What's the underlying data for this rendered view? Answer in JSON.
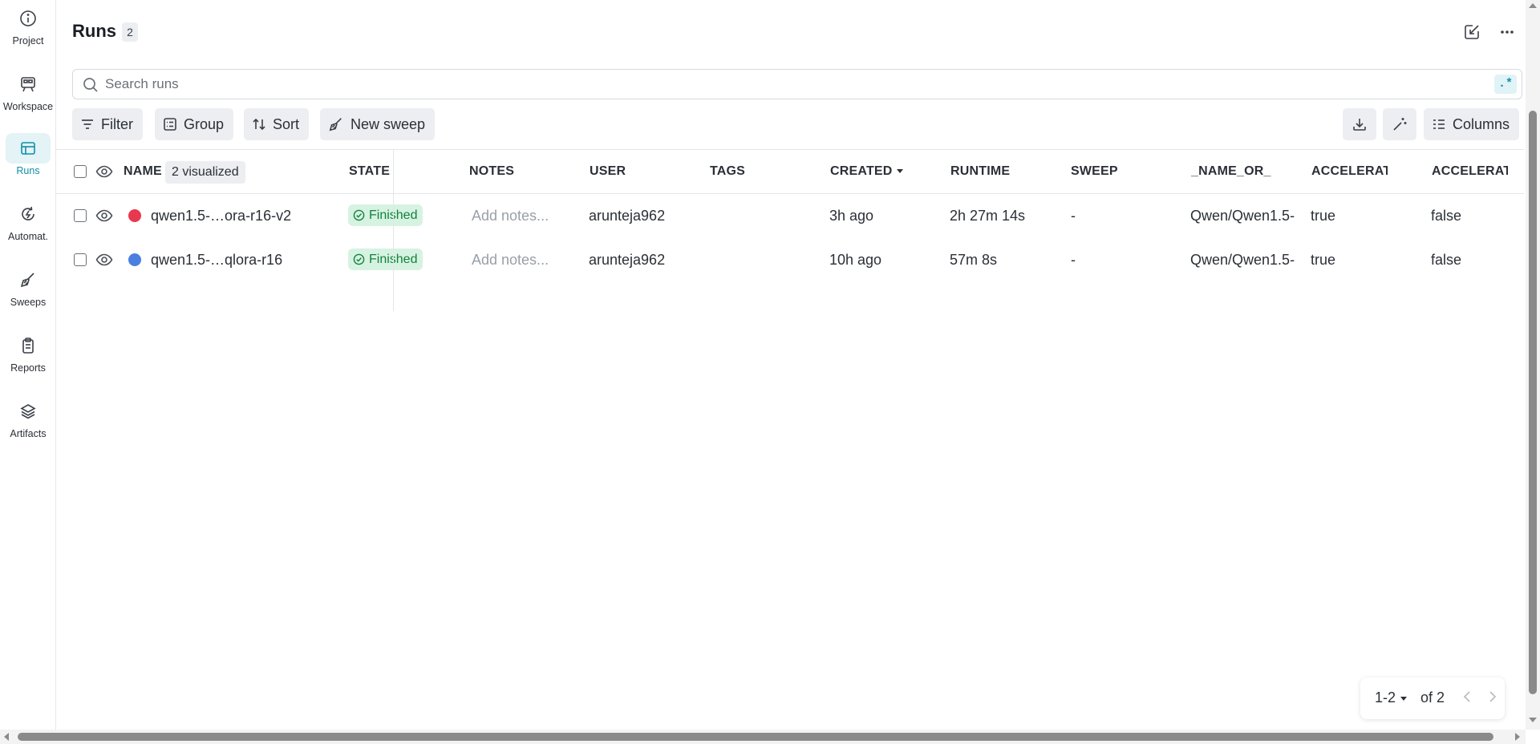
{
  "nav": {
    "items": [
      {
        "label": "Project",
        "icon": "info-icon"
      },
      {
        "label": "Workspace",
        "icon": "workspace-icon"
      },
      {
        "label": "Runs",
        "icon": "table-icon",
        "active": true
      },
      {
        "label": "Automat.",
        "icon": "automation-icon"
      },
      {
        "label": "Sweeps",
        "icon": "broom-icon"
      },
      {
        "label": "Reports",
        "icon": "clipboard-icon"
      },
      {
        "label": "Artifacts",
        "icon": "layers-icon"
      }
    ]
  },
  "header": {
    "title": "Runs",
    "count": "2"
  },
  "search": {
    "placeholder": "Search runs",
    "value": "",
    "regex_label": ".*"
  },
  "toolbar": {
    "filter_label": "Filter",
    "group_label": "Group",
    "sort_label": "Sort",
    "new_sweep_label": "New sweep",
    "columns_label": "Columns"
  },
  "table": {
    "visualized_label": "2 visualized",
    "columns": {
      "name": "NAME",
      "state": "STATE",
      "notes": "NOTES",
      "user": "USER",
      "tags": "TAGS",
      "created": "CREATED",
      "runtime": "RUNTIME",
      "sweep": "SWEEP",
      "name_or": "_NAME_OR_",
      "accel1": "ACCELERATC",
      "accel2": "ACCELERATC"
    },
    "rows": [
      {
        "name": "qwen1.5-…ora-r16-v2",
        "color": "#e8384f",
        "state": "Finished",
        "notes": "Add notes...",
        "user": "arunteja962",
        "tags": "",
        "created": "3h ago",
        "runtime": "2h 27m 14s",
        "sweep": "-",
        "name_or": "Qwen/Qwen1.5-",
        "accel1": "true",
        "accel2": "false"
      },
      {
        "name": "qwen1.5-…qlora-r16",
        "color": "#4a7fe0",
        "state": "Finished",
        "notes": "Add notes...",
        "user": "arunteja962",
        "tags": "",
        "created": "10h ago",
        "runtime": "57m 8s",
        "sweep": "-",
        "name_or": "Qwen/Qwen1.5-",
        "accel1": "true",
        "accel2": "false"
      }
    ]
  },
  "pager": {
    "range": "1-2",
    "of": "of 2"
  },
  "colors": {
    "accent": "#0f8fa7",
    "finished_bg": "#d6f3e2",
    "finished_text": "#15803d"
  }
}
